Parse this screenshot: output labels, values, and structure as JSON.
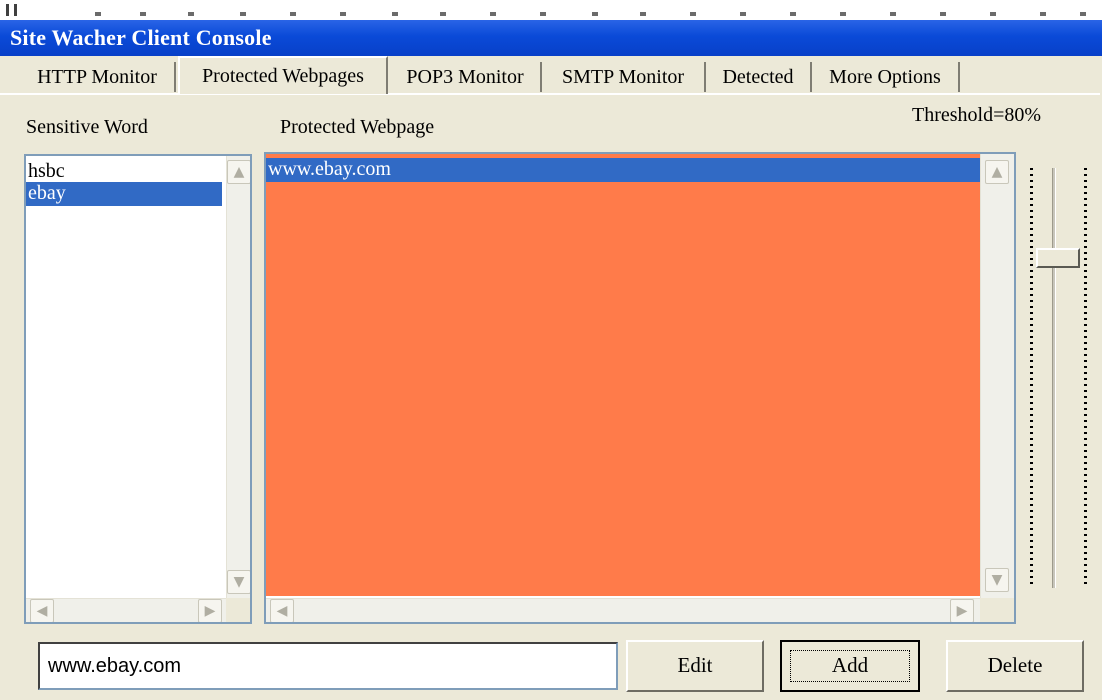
{
  "window": {
    "title": "Site Wacher Client Console"
  },
  "tabs": [
    {
      "label": "HTTP Monitor",
      "active": false
    },
    {
      "label": "Protected Webpages",
      "active": true
    },
    {
      "label": "POP3 Monitor",
      "active": false
    },
    {
      "label": "SMTP Monitor",
      "active": false
    },
    {
      "label": "Detected",
      "active": false
    },
    {
      "label": "More Options",
      "active": false
    }
  ],
  "labels": {
    "sensitive_word": "Sensitive Word",
    "protected_webpage": "Protected Webpage",
    "threshold": "Threshold=80%"
  },
  "sensitive_words": [
    {
      "text": "hsbc",
      "selected": false
    },
    {
      "text": "ebay",
      "selected": true
    }
  ],
  "protected_webpages": [
    {
      "text": "www.ebay.com",
      "selected": true
    }
  ],
  "threshold_value": 80,
  "input": {
    "value": "www.ebay.com"
  },
  "buttons": {
    "edit": "Edit",
    "add": "Add",
    "delete": "Delete"
  },
  "colors": {
    "title_bar": "#0a4ad8",
    "selection": "#316ac5",
    "webpage_list_bg": "#ff7b4a",
    "window_bg": "#ece9d8"
  }
}
